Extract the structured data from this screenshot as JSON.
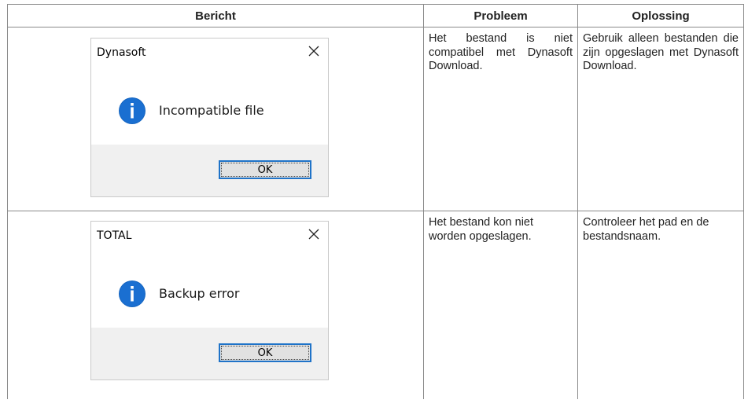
{
  "table": {
    "headers": [
      "Bericht",
      "Probleem",
      "Oplossing"
    ],
    "rows": [
      {
        "dialog": {
          "title": "Dynasoft",
          "icon": "info-icon",
          "message": "Incompatible file",
          "button": "OK"
        },
        "problem": "Het bestand is niet compatibel met Dynasoft Download.",
        "solution": "Gebruik alleen bestanden die zijn opgeslagen met Dynasoft Download."
      },
      {
        "dialog": {
          "title": "TOTAL",
          "icon": "info-icon",
          "message": "Backup error",
          "button": "OK"
        },
        "problem": "Het bestand kon niet worden opgeslagen.",
        "solution": "Controleer het pad en de bestandsnaam."
      }
    ]
  },
  "colors": {
    "info_icon": "#1565c0",
    "button_focus": "#1f73c8",
    "dialog_footer": "#f0f0f0"
  }
}
